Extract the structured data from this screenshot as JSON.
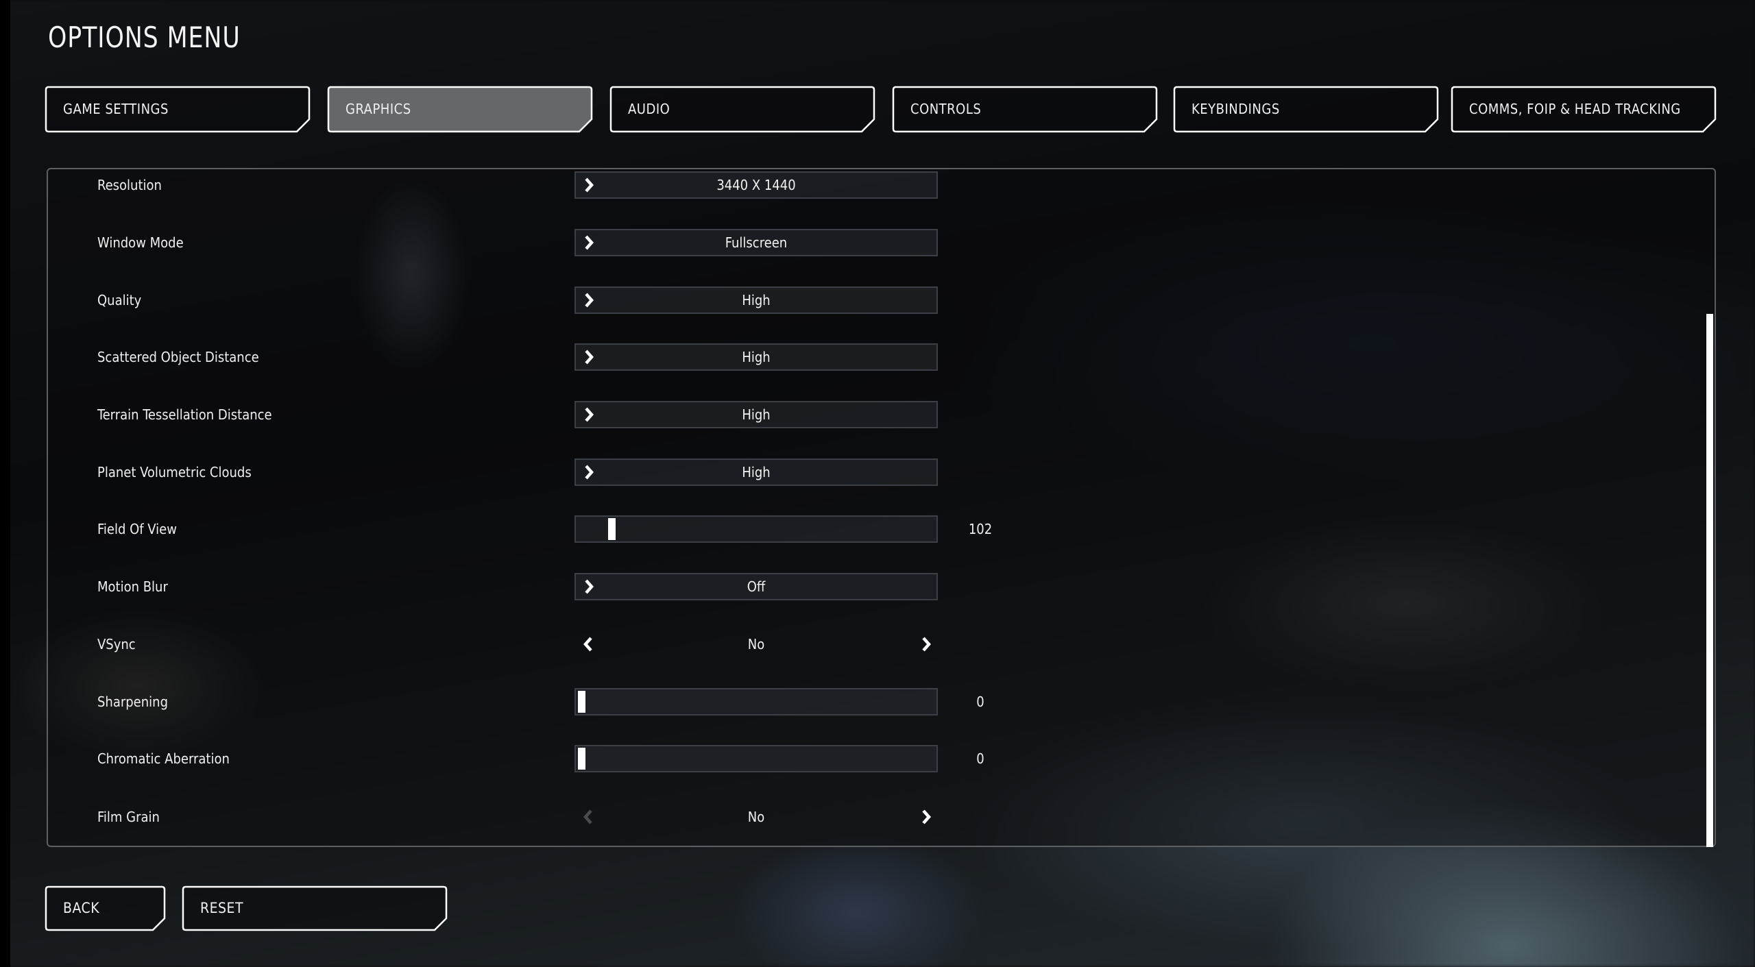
{
  "title": "OPTIONS MENU",
  "colors": {
    "active_tab_fill": "#6a6b6e",
    "frame": "#ffffff",
    "control_border": "#3c4046",
    "disabled_arrow": "#4a4c50"
  },
  "tabs": [
    {
      "label": "GAME SETTINGS",
      "active": false
    },
    {
      "label": "GRAPHICS",
      "active": true
    },
    {
      "label": "AUDIO",
      "active": false
    },
    {
      "label": "CONTROLS",
      "active": false
    },
    {
      "label": "KEYBINDINGS",
      "active": false
    },
    {
      "label": "COMMS, FOIP & HEAD TRACKING",
      "active": false
    }
  ],
  "settings": [
    {
      "label": "Resolution",
      "type": "dropdown",
      "value": "3440 X 1440",
      "icon": "chevron-right-icon"
    },
    {
      "label": "Window Mode",
      "type": "dropdown",
      "value": "Fullscreen",
      "icon": "chevron-right-icon"
    },
    {
      "label": "Quality",
      "type": "dropdown",
      "value": "High",
      "icon": "chevron-right-icon"
    },
    {
      "label": "Scattered Object Distance",
      "type": "dropdown",
      "value": "High",
      "icon": "chevron-right-icon"
    },
    {
      "label": "Terrain Tessellation Distance",
      "type": "dropdown",
      "value": "High",
      "icon": "chevron-right-icon"
    },
    {
      "label": "Planet Volumetric Clouds",
      "type": "dropdown",
      "value": "High",
      "icon": "chevron-right-icon"
    },
    {
      "label": "Field Of View",
      "type": "slider",
      "value": "102",
      "fraction": 0.085
    },
    {
      "label": "Motion Blur",
      "type": "dropdown",
      "value": "Off",
      "icon": "chevron-right-icon"
    },
    {
      "label": "VSync",
      "type": "toggle",
      "value": "No",
      "left_enabled": true,
      "right_enabled": true
    },
    {
      "label": "Sharpening",
      "type": "slider",
      "value": "0",
      "fraction": 0
    },
    {
      "label": "Chromatic Aberration",
      "type": "slider",
      "value": "0",
      "fraction": 0
    },
    {
      "label": "Film Grain",
      "type": "toggle",
      "value": "No",
      "left_enabled": false,
      "right_enabled": true
    }
  ],
  "scrollbar": {
    "position_fraction": 1.0,
    "visible_fraction": 0.78
  },
  "buttons": {
    "back": "BACK",
    "reset": "RESET"
  }
}
